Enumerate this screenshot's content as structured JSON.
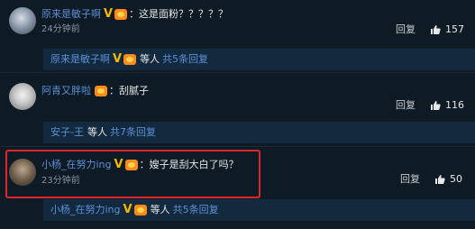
{
  "comments": [
    {
      "username": "原来是敏子啊",
      "badge_v": "V",
      "content": "：这是面粉？？？？？",
      "time": "24分钟前",
      "reply_label": "回复",
      "likes": "157",
      "subreply": {
        "name": "原来是敏子啊",
        "badge_v": "V",
        "etc": "等人",
        "count": "共5条回复"
      }
    },
    {
      "username": "阿青又胖啦",
      "content": "：刮腻子",
      "reply_label": "回复",
      "likes": "116",
      "subreply": {
        "name": "安子-王",
        "etc": "等人",
        "count": "共7条回复"
      }
    },
    {
      "username": "小杨_在努力ing",
      "badge_v": "V",
      "content": "：嫂子是刮大白了吗？",
      "time": "23分钟前",
      "reply_label": "回复",
      "likes": "50",
      "subreply": {
        "name": "小杨_在努力ing",
        "badge_v": "V",
        "etc": "等人",
        "count": "共5条回复"
      }
    }
  ],
  "colors": {
    "background": "#0e1a24",
    "username": "#5c8fd6",
    "highlight_border": "#e0262a",
    "subreply_bg": "#132a3e"
  },
  "icons": {
    "like": "thumbs-up-icon",
    "badge_fan": "fan-badge-icon"
  }
}
